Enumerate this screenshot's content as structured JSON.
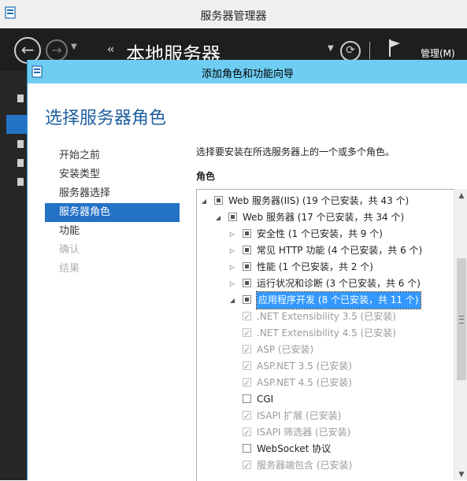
{
  "server_manager": {
    "title": "服务器管理器",
    "breadcrumb_arrows": "‹‹",
    "breadcrumb": "本地服务器",
    "manage_menu": "管理(M)"
  },
  "wizard": {
    "title": "添加角色和功能向导",
    "heading": "选择服务器角色",
    "steps": [
      {
        "label": "开始之前",
        "state": "normal"
      },
      {
        "label": "安装类型",
        "state": "normal"
      },
      {
        "label": "服务器选择",
        "state": "normal"
      },
      {
        "label": "服务器角色",
        "state": "active"
      },
      {
        "label": "功能",
        "state": "normal"
      },
      {
        "label": "确认",
        "state": "disabled"
      },
      {
        "label": "结果",
        "state": "disabled"
      }
    ],
    "instruction": "选择要安装在所选服务器上的一个或多个角色。",
    "roles_label": "角色",
    "tree": [
      {
        "label": "Web 服务器(IIS) (19 个已安装，共 43 个)",
        "expander": "expanded",
        "check": "partial",
        "level": 0,
        "style": "dark"
      },
      {
        "label": "Web 服务器 (17 个已安装，共 34 个)",
        "expander": "expanded",
        "check": "partial",
        "level": 1,
        "style": "dark"
      },
      {
        "label": "安全性 (1 个已安装，共 9 个)",
        "expander": "collapsed",
        "check": "partial",
        "level": 2,
        "style": "dark"
      },
      {
        "label": "常见 HTTP 功能 (4 个已安装，共 6 个)",
        "expander": "collapsed",
        "check": "partial",
        "level": 2,
        "style": "dark"
      },
      {
        "label": "性能 (1 个已安装，共 2 个)",
        "expander": "collapsed",
        "check": "partial",
        "level": 2,
        "style": "dark"
      },
      {
        "label": "运行状况和诊断 (3 个已安装，共 6 个)",
        "expander": "collapsed",
        "check": "partial",
        "level": 2,
        "style": "dark"
      },
      {
        "label": "应用程序开发 (8 个已安装，共 11 个)",
        "expander": "expanded",
        "check": "partial",
        "level": 2,
        "style": "selected"
      },
      {
        "label": ".NET Extensibility 3.5 (已安装)",
        "expander": "none",
        "check": "checked",
        "level": 3,
        "style": "grey"
      },
      {
        "label": ".NET Extensibility 4.5 (已安装)",
        "expander": "none",
        "check": "checked",
        "level": 3,
        "style": "grey"
      },
      {
        "label": "ASP (已安装)",
        "expander": "none",
        "check": "checked",
        "level": 3,
        "style": "grey"
      },
      {
        "label": "ASP.NET 3.5 (已安装)",
        "expander": "none",
        "check": "checked",
        "level": 3,
        "style": "grey"
      },
      {
        "label": "ASP.NET 4.5 (已安装)",
        "expander": "none",
        "check": "checked",
        "level": 3,
        "style": "grey"
      },
      {
        "label": "CGI",
        "expander": "none",
        "check": "unchecked",
        "level": 3,
        "style": "dark"
      },
      {
        "label": "ISAPI 扩展 (已安装)",
        "expander": "none",
        "check": "checked",
        "level": 3,
        "style": "grey"
      },
      {
        "label": "ISAPI 筛选器 (已安装)",
        "expander": "none",
        "check": "checked",
        "level": 3,
        "style": "grey"
      },
      {
        "label": "WebSocket 协议",
        "expander": "none",
        "check": "unchecked",
        "level": 3,
        "style": "dark"
      },
      {
        "label": "服务器端包含 (已安装)",
        "expander": "none",
        "check": "checked",
        "level": 3,
        "style": "grey"
      }
    ]
  },
  "colors": {
    "wizard_titlebar": "#6fcdf2",
    "selected_step": "#2472c6",
    "heading": "#1f5f9f",
    "tree_selection": "#3399ff"
  }
}
